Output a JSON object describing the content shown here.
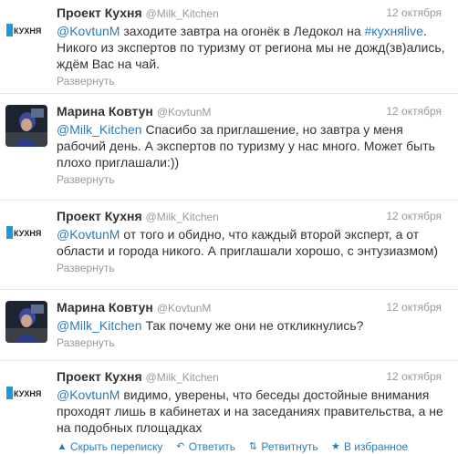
{
  "tweets": [
    {
      "author": "Проект Кухня",
      "handle": "@Milk_Kitchen",
      "time": "12 октября",
      "avatar_label": "КУХНЯ",
      "segments": [
        {
          "t": "@KovtunM",
          "link": true
        },
        {
          "t": " заходите завтра на огонёк в Ледокол на ",
          "link": false
        },
        {
          "t": "#кухняlive",
          "link": true
        },
        {
          "t": ". Никого из экспертов по туризму от региона мы не дожд(зв)ались, ждём Вас на чай.",
          "link": false
        }
      ],
      "expand": "Развернуть"
    },
    {
      "author": "Марина Ковтун",
      "handle": "@KovtunM",
      "time": "12 октября",
      "segments": [
        {
          "t": "@Milk_Kitchen",
          "link": true
        },
        {
          "t": " Спасибо за приглашение, но завтра у меня рабочий день. А экспертов по туризму у нас много. Может быть плохо приглашали:))",
          "link": false
        }
      ],
      "expand": "Развернуть"
    },
    {
      "author": "Проект Кухня",
      "handle": "@Milk_Kitchen",
      "time": "12 октября",
      "avatar_label": "КУХНЯ",
      "segments": [
        {
          "t": "@KovtunM",
          "link": true
        },
        {
          "t": " от того и обидно, что каждый второй эксперт, а от области и города никого. А приглашали хорошо, с энтузиазмом)",
          "link": false
        }
      ],
      "expand": "Развернуть"
    },
    {
      "author": "Марина Ковтун",
      "handle": "@KovtunM",
      "time": "12 октября",
      "segments": [
        {
          "t": "@Milk_Kitchen",
          "link": true
        },
        {
          "t": " Так почему же они не откликнулись?",
          "link": false
        }
      ],
      "expand": "Развернуть"
    },
    {
      "author": "Проект Кухня",
      "handle": "@Milk_Kitchen",
      "time": "12 октября",
      "avatar_label": "КУХНЯ",
      "segments": [
        {
          "t": "@KovtunM",
          "link": true
        },
        {
          "t": " видимо, уверены, что беседы достойные внимания проходят лишь в кабинетах и на заседаниях правительства, а не на подобных площадках",
          "link": false
        }
      ]
    }
  ],
  "actions": {
    "hide": "Скрыть переписку",
    "reply": "Ответить",
    "retweet": "Ретвитнуть",
    "favorite": "В избранное"
  },
  "icons": {
    "hide": "collapse-icon",
    "reply": "reply-icon",
    "retweet": "retweet-icon",
    "favorite": "star-icon"
  },
  "colors": {
    "link": "#2b7bb9",
    "meta": "#999999",
    "text": "#333333",
    "brand": "#1a9ad6"
  }
}
